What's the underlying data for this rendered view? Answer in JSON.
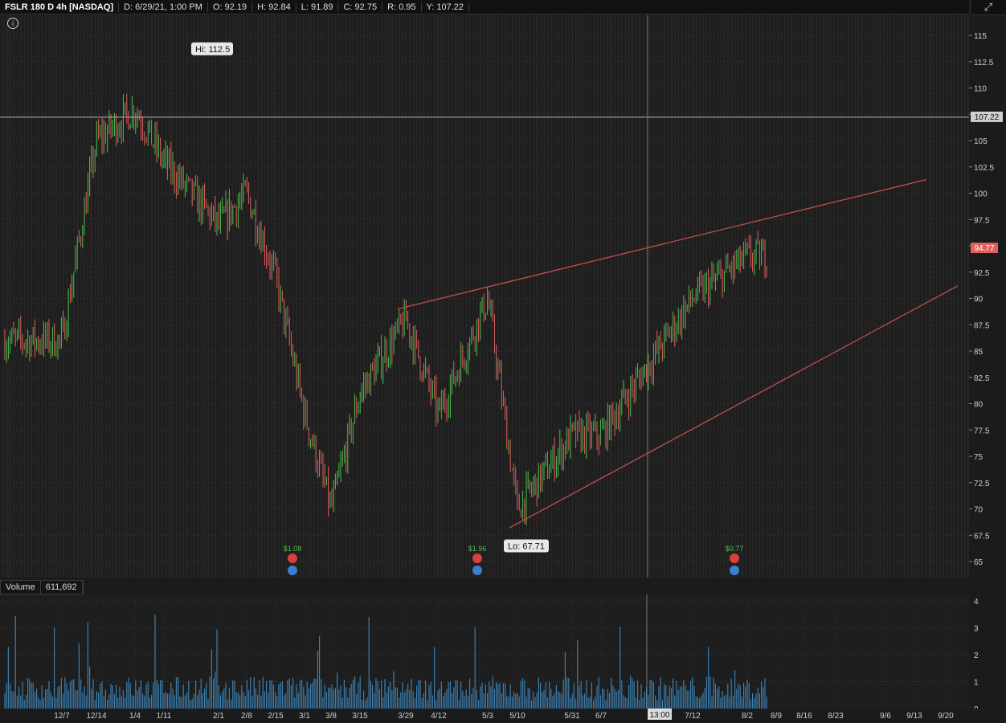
{
  "header": {
    "symbol": "FSLR 180 D 4h [NASDAQ]",
    "date": "D: 6/29/21, 1:00 PM",
    "open": "O: 92.19",
    "high": "H: 92.84",
    "low": "L: 91.89",
    "close": "C: 92.75",
    "range": "R: 0.95",
    "cursor_y": "Y: 107.22"
  },
  "corner_icon": "expand-arrow-icon",
  "info_icon": "info-icon",
  "colors": {
    "up": "#4fbf4f",
    "down": "#e0605e",
    "volume": "#3b7fb0",
    "trendline": "#c0504d",
    "current_price": "#e0605e"
  },
  "price_axis": {
    "ticks": [
      "115",
      "112.5",
      "110",
      "107.5",
      "105",
      "102.5",
      "100",
      "97.5",
      "95",
      "92.5",
      "90",
      "87.5",
      "85",
      "82.5",
      "80",
      "77.5",
      "75",
      "72.5",
      "70",
      "67.5",
      "65"
    ],
    "cursor_label": "107.22",
    "last_label": "94.77"
  },
  "volume": {
    "label": "Volume",
    "value": "611,692",
    "axis_ticks": [
      "4",
      "3",
      "2",
      "1",
      "0"
    ]
  },
  "time_axis": {
    "ticks": [
      "12/7",
      "12/14",
      "1/4",
      "1/11",
      "2/1",
      "2/8",
      "2/15",
      "3/1",
      "3/8",
      "3/15",
      "3/29",
      "4/12",
      "5/3",
      "5/10",
      "5/31",
      "6/7",
      "7/12",
      "8/2",
      "8/9",
      "8/16",
      "8/23",
      "9/6",
      "9/13",
      "9/20"
    ],
    "cursor_label": "13:00"
  },
  "annotations": {
    "high": "Hi: 112.5",
    "low": "Lo: 67.71",
    "dividends": [
      "$1.08",
      "$1.96",
      "$0.77"
    ]
  },
  "chart_data": {
    "type": "candlestick",
    "series": [
      {
        "name": "",
        "x": [
          "12/7",
          "12/14",
          "1/4",
          "1/11",
          "2/1",
          "2/8",
          "2/15",
          "3/1",
          "3/8",
          "3/15",
          "3/29",
          "4/12",
          "5/3",
          "5/10",
          "5/31",
          "6/7",
          "7/12",
          "8/2"
        ],
        "values": [
          86,
          105,
          108,
          103,
          97,
          100,
          92,
          79,
          70,
          81,
          88,
          79,
          90,
          70,
          77,
          77,
          90,
          94
        ]
      }
    ],
    "ylim": [
      64,
      117
    ],
    "y_right_ticks": [
      115,
      112.5,
      110,
      107.5,
      105,
      102.5,
      100,
      97.5,
      95,
      92.5,
      90,
      87.5,
      85,
      82.5,
      80,
      77.5,
      75,
      72.5,
      70,
      67.5,
      65
    ],
    "high": 112.5,
    "low": 67.71,
    "crosshair_y": 107.22,
    "last_price": 94.77,
    "trendlines": [
      {
        "from": [
          "3/29",
          89.0
        ],
        "to": [
          "9/13",
          101.3
        ]
      },
      {
        "from": [
          "5/10",
          68.2
        ],
        "to": [
          "9/20",
          91.2
        ]
      }
    ],
    "volume_ylim": [
      0,
      4
    ],
    "grid": true,
    "legend": "none"
  }
}
